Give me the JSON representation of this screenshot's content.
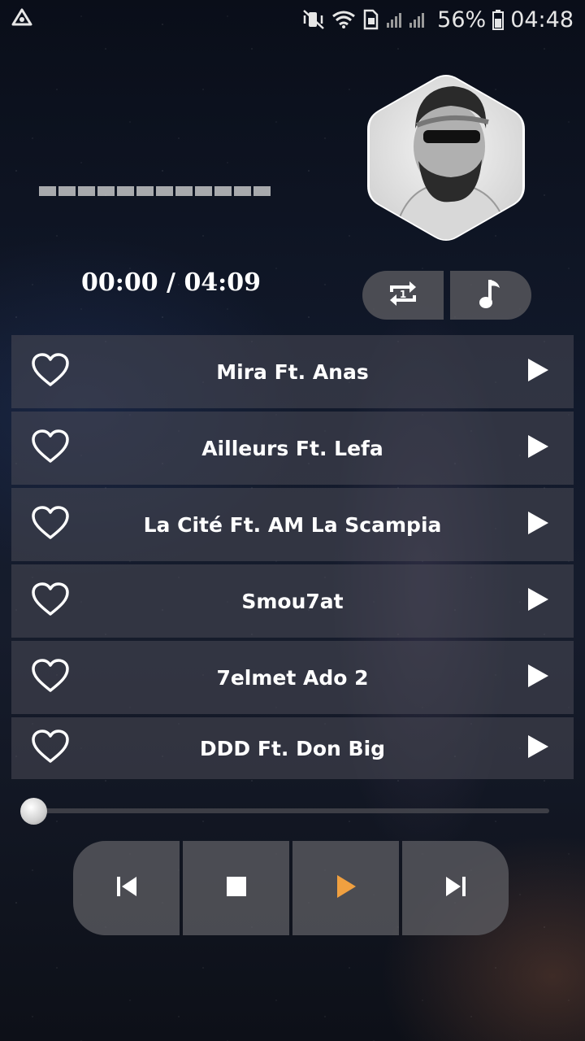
{
  "status_bar": {
    "battery": "56%",
    "time": "04:48"
  },
  "player": {
    "elapsed": "00:00",
    "separator": " / ",
    "duration": "04:09",
    "progress": 0,
    "equalizer_levels": [
      1,
      1,
      1,
      1,
      1,
      1,
      1,
      1,
      1,
      1,
      1,
      1
    ]
  },
  "mode_buttons": [
    {
      "icon": "repeat-one-icon"
    },
    {
      "icon": "music-note-icon"
    }
  ],
  "tracks": [
    {
      "title": "Mira Ft. Anas"
    },
    {
      "title": "Ailleurs Ft. Lefa"
    },
    {
      "title": "La Cité Ft. AM La Scampia"
    },
    {
      "title": "Smou7at"
    },
    {
      "title": "7elmet Ado 2"
    },
    {
      "title": "DDD Ft. Don Big"
    }
  ],
  "controls": [
    {
      "icon": "skip-previous-icon"
    },
    {
      "icon": "stop-icon"
    },
    {
      "icon": "play-icon",
      "color": "#f0a040"
    },
    {
      "icon": "skip-next-icon"
    }
  ],
  "colors": {
    "accent": "#f0a040",
    "panel": "#4b4b55"
  }
}
